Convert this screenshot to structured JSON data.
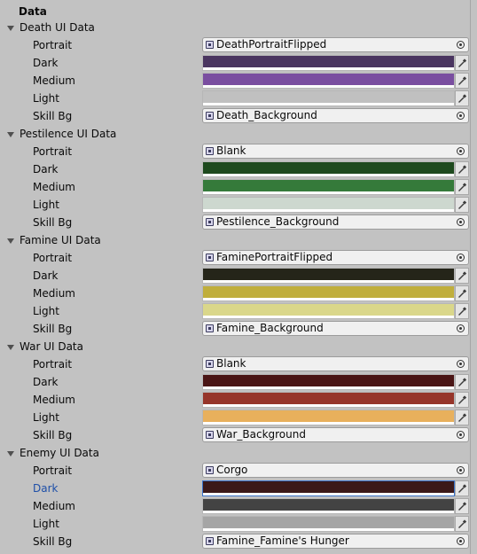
{
  "header": {
    "title": "Data"
  },
  "labels": {
    "portrait": "Portrait",
    "dark": "Dark",
    "medium": "Medium",
    "light": "Light",
    "skill_bg": "Skill Bg"
  },
  "groups": [
    {
      "title": "Death UI Data",
      "portrait": "DeathPortraitFlipped",
      "dark": "#4a3560",
      "medium": "#7a4ea0",
      "light": "#c0c0c0",
      "skill_bg": "Death_Background"
    },
    {
      "title": "Pestilence UI Data",
      "portrait": "Blank",
      "dark": "#1e4a1e",
      "medium": "#357a3a",
      "light": "#cdd8cf",
      "skill_bg": "Pestilence_Background"
    },
    {
      "title": "Famine UI Data",
      "portrait": "FaminePortraitFlipped",
      "dark": "#252519",
      "medium": "#c0ae3c",
      "light": "#dad78a",
      "skill_bg": "Famine_Background"
    },
    {
      "title": "War UI Data",
      "portrait": "Blank",
      "dark": "#4a1515",
      "medium": "#96352a",
      "light": "#e8b05c",
      "skill_bg": "War_Background"
    },
    {
      "title": "Enemy UI Data",
      "portrait": "Corgo",
      "dark": "#3b1919",
      "medium": "#434343",
      "light": "#a5a5a5",
      "skill_bg": "Famine_Famine's Hunger"
    }
  ]
}
